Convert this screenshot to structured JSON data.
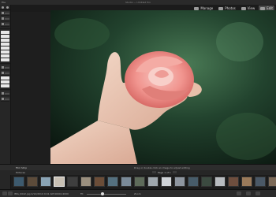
{
  "window": {
    "title": "Studio — Untitled Pro"
  },
  "menu": {
    "left_label": "File"
  },
  "tabs": [
    {
      "label": "Manage",
      "icon": "manage-icon"
    },
    {
      "label": "Photos",
      "icon": "photos-icon"
    },
    {
      "label": "View",
      "icon": "view-icon"
    },
    {
      "label": "Edit",
      "icon": "edit-icon",
      "active": true
    }
  ],
  "filmstrip": {
    "title": "Film Strip",
    "hint": "Drag or double click an image to adjust editing",
    "source": "Pictures",
    "pager": "Page 1 of 1",
    "thumb_colors": [
      "#3d5a6e",
      "#5c4b3a",
      "#8aa4b5",
      "#c8c0b4",
      "#3e3e3e",
      "#9a8f7e",
      "#6b4d38",
      "#54707f",
      "#7a8a98",
      "#5e6b5a",
      "#a0a8ae",
      "#d0d4d8",
      "#8e96a0",
      "#475c6a",
      "#3b4a40",
      "#b8bcc0",
      "#6e4e3e",
      "#9a7a5a",
      "#4a5866",
      "#7c6a58"
    ],
    "selected_index": 3
  },
  "status": {
    "text": "IMG_0042.jpg 4/12/2019 9:41 AM 6000×4000",
    "zoom_label": "Fit",
    "right_text": "Zoom"
  },
  "colors": {
    "accent": "#e0e0e0",
    "background": "#1b1b1b",
    "panel": "#262626"
  }
}
